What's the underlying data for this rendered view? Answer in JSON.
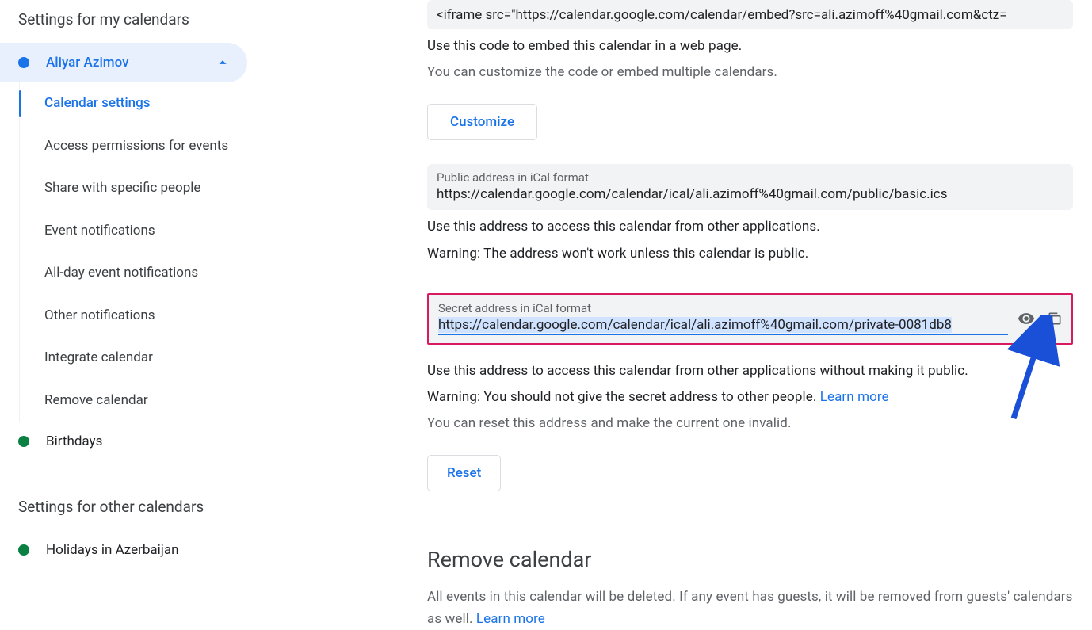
{
  "sidebar": {
    "myCalTitle": "Settings for my calendars",
    "otherCalTitle": "Settings for other calendars",
    "activeCalendar": "Aliyar Azimov",
    "activeDotColor": "#1a73e8",
    "birthdays": {
      "label": "Birthdays",
      "dotColor": "#0b8043"
    },
    "holidays": {
      "label": "Holidays in Azerbaijan",
      "dotColor": "#0b8043"
    },
    "submenu": [
      "Calendar settings",
      "Access permissions for events",
      "Share with specific people",
      "Event notifications",
      "All-day event notifications",
      "Other notifications",
      "Integrate calendar",
      "Remove calendar"
    ]
  },
  "main": {
    "iframe": {
      "value": "<iframe src=\"https://calendar.google.com/calendar/embed?src=ali.azimoff%40gmail.com&ctz="
    },
    "embedDesc1": "Use this code to embed this calendar in a web page.",
    "embedDesc2": "You can customize the code or embed multiple calendars.",
    "customizeBtn": "Customize",
    "publicIcal": {
      "label": "Public address in iCal format",
      "value": "https://calendar.google.com/calendar/ical/ali.azimoff%40gmail.com/public/basic.ics"
    },
    "publicDesc": "Use this address to access this calendar from other applications.",
    "publicWarn": "Warning: The address won't work unless this calendar is public.",
    "secretIcal": {
      "label": "Secret address in iCal format",
      "value": "https://calendar.google.com/calendar/ical/ali.azimoff%40gmail.com/private-0081db8"
    },
    "secretDesc": "Use this address to access this calendar from other applications without making it public.",
    "secretWarnPrefix": "Warning: You should not give the secret address to other people. ",
    "secretReset": "You can reset this address and make the current one invalid.",
    "learnMore": "Learn more",
    "resetBtn": "Reset",
    "removeHeading": "Remove calendar",
    "removeDescPrefix": "All events in this calendar will be deleted. If any event has guests, it will be removed from guests' calendars as well. "
  }
}
